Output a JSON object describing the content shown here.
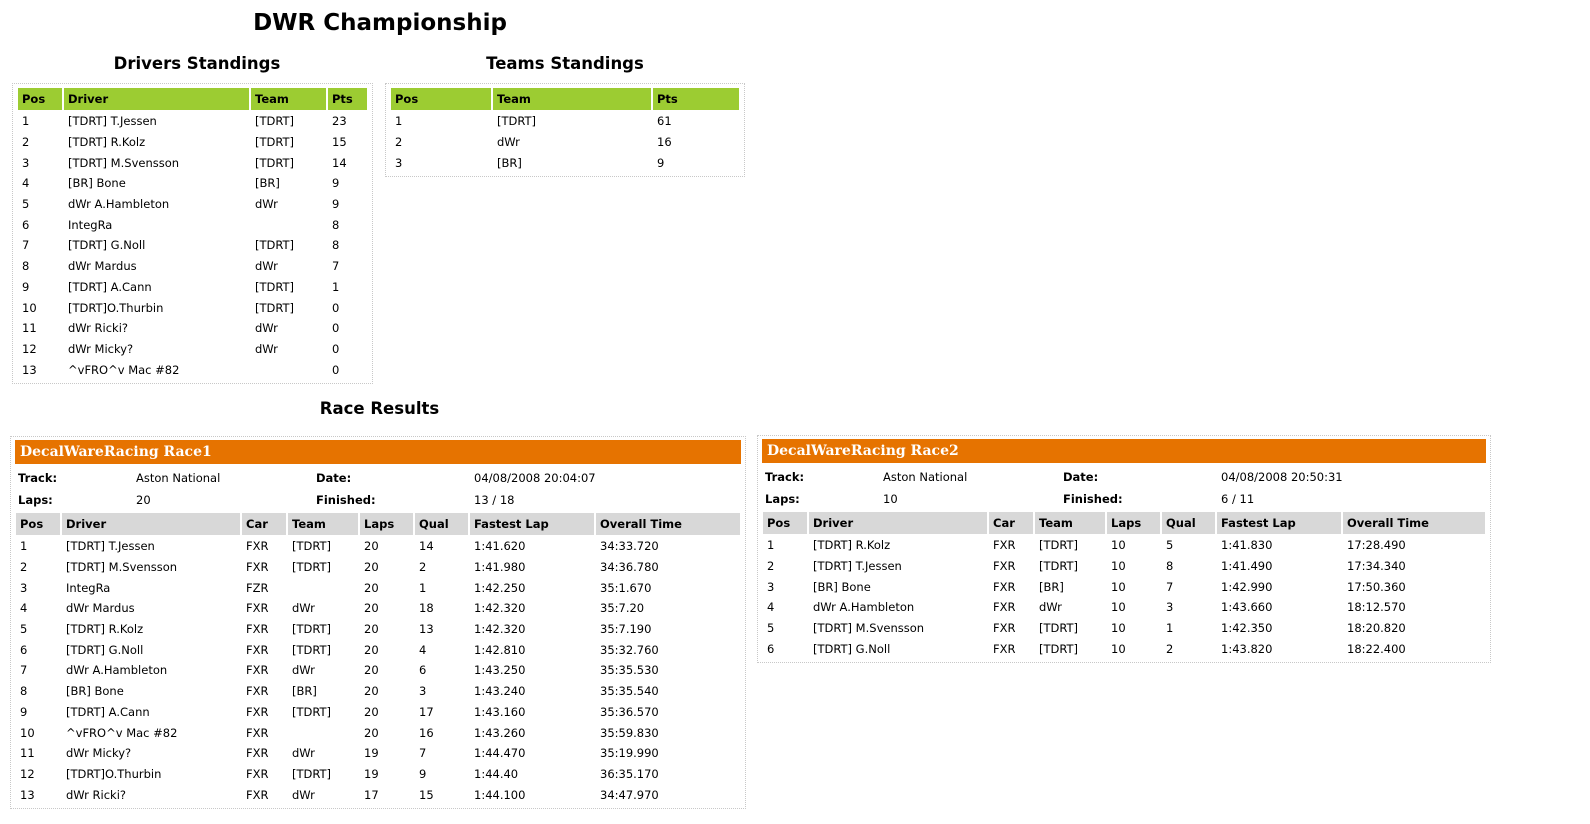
{
  "page": {
    "title": "DWR Championship"
  },
  "drivers": {
    "heading": "Drivers Standings",
    "columns": [
      "Pos",
      "Driver",
      "Team",
      "Pts"
    ],
    "rows": [
      [
        "1",
        "[TDRT] T.Jessen",
        "[TDRT]",
        "23"
      ],
      [
        "2",
        "[TDRT] R.Kolz",
        "[TDRT]",
        "15"
      ],
      [
        "3",
        "[TDRT] M.Svensson",
        "[TDRT]",
        "14"
      ],
      [
        "4",
        "[BR] Bone",
        "[BR]",
        "9"
      ],
      [
        "5",
        "dWr A.Hambleton",
        "dWr",
        "9"
      ],
      [
        "6",
        "IntegRa",
        "",
        "8"
      ],
      [
        "7",
        "[TDRT] G.Noll",
        "[TDRT]",
        "8"
      ],
      [
        "8",
        "dWr Mardus",
        "dWr",
        "7"
      ],
      [
        "9",
        "[TDRT] A.Cann",
        "[TDRT]",
        "1"
      ],
      [
        "10",
        "[TDRT]O.Thurbin",
        "[TDRT]",
        "0"
      ],
      [
        "11",
        "dWr Ricki?",
        "dWr",
        "0"
      ],
      [
        "12",
        "dWr Micky?",
        "dWr",
        "0"
      ],
      [
        "13",
        "^vFRO^v Mac #82",
        "",
        "0"
      ]
    ]
  },
  "teams": {
    "heading": "Teams Standings",
    "columns": [
      "Pos",
      "Team",
      "Pts"
    ],
    "rows": [
      [
        "1",
        "[TDRT]",
        "61"
      ],
      [
        "2",
        "dWr",
        "16"
      ],
      [
        "3",
        "[BR]",
        "9"
      ]
    ]
  },
  "results": {
    "heading": "Race Results",
    "columns": [
      "Pos",
      "Driver",
      "Car",
      "Team",
      "Laps",
      "Qual",
      "Fastest Lap",
      "Overall Time"
    ],
    "labels": {
      "track": "Track:",
      "laps": "Laps:",
      "date": "Date:",
      "finished": "Finished:"
    },
    "races": [
      {
        "name": "DecalWareRacing Race1",
        "track": "Aston National",
        "laps": "20",
        "date": "04/08/2008 20:04:07",
        "finished": "13 / 18",
        "rows": [
          [
            "1",
            "[TDRT] T.Jessen",
            "FXR",
            "[TDRT]",
            "20",
            "14",
            "1:41.620",
            "34:33.720"
          ],
          [
            "2",
            "[TDRT] M.Svensson",
            "FXR",
            "[TDRT]",
            "20",
            "2",
            "1:41.980",
            "34:36.780"
          ],
          [
            "3",
            "IntegRa",
            "FZR",
            "",
            "20",
            "1",
            "1:42.250",
            "35:1.670"
          ],
          [
            "4",
            "dWr Mardus",
            "FXR",
            "dWr",
            "20",
            "18",
            "1:42.320",
            "35:7.20"
          ],
          [
            "5",
            "[TDRT] R.Kolz",
            "FXR",
            "[TDRT]",
            "20",
            "13",
            "1:42.320",
            "35:7.190"
          ],
          [
            "6",
            "[TDRT] G.Noll",
            "FXR",
            "[TDRT]",
            "20",
            "4",
            "1:42.810",
            "35:32.760"
          ],
          [
            "7",
            "dWr A.Hambleton",
            "FXR",
            "dWr",
            "20",
            "6",
            "1:43.250",
            "35:35.530"
          ],
          [
            "8",
            "[BR] Bone",
            "FXR",
            "[BR]",
            "20",
            "3",
            "1:43.240",
            "35:35.540"
          ],
          [
            "9",
            "[TDRT] A.Cann",
            "FXR",
            "[TDRT]",
            "20",
            "17",
            "1:43.160",
            "35:36.570"
          ],
          [
            "10",
            "^vFRO^v Mac #82",
            "FXR",
            "",
            "20",
            "16",
            "1:43.260",
            "35:59.830"
          ],
          [
            "11",
            "dWr Micky?",
            "FXR",
            "dWr",
            "19",
            "7",
            "1:44.470",
            "35:19.990"
          ],
          [
            "12",
            "[TDRT]O.Thurbin",
            "FXR",
            "[TDRT]",
            "19",
            "9",
            "1:44.40",
            "36:35.170"
          ],
          [
            "13",
            "dWr Ricki?",
            "FXR",
            "dWr",
            "17",
            "15",
            "1:44.100",
            "34:47.970"
          ]
        ]
      },
      {
        "name": "DecalWareRacing Race2",
        "track": "Aston National",
        "laps": "10",
        "date": "04/08/2008 20:50:31",
        "finished": "6 / 11",
        "rows": [
          [
            "1",
            "[TDRT] R.Kolz",
            "FXR",
            "[TDRT]",
            "10",
            "5",
            "1:41.830",
            "17:28.490"
          ],
          [
            "2",
            "[TDRT] T.Jessen",
            "FXR",
            "[TDRT]",
            "10",
            "8",
            "1:41.490",
            "17:34.340"
          ],
          [
            "3",
            "[BR] Bone",
            "FXR",
            "[BR]",
            "10",
            "7",
            "1:42.990",
            "17:50.360"
          ],
          [
            "4",
            "dWr A.Hambleton",
            "FXR",
            "dWr",
            "10",
            "3",
            "1:43.660",
            "18:12.570"
          ],
          [
            "5",
            "[TDRT] M.Svensson",
            "FXR",
            "[TDRT]",
            "10",
            "1",
            "1:42.350",
            "18:20.820"
          ],
          [
            "6",
            "[TDRT] G.Noll",
            "FXR",
            "[TDRT]",
            "10",
            "2",
            "1:43.820",
            "18:22.400"
          ]
        ]
      }
    ]
  },
  "colors": {
    "standings_header": "#9ccc32",
    "race_title_bar": "#e67300",
    "results_header": "#d8d8d8"
  }
}
